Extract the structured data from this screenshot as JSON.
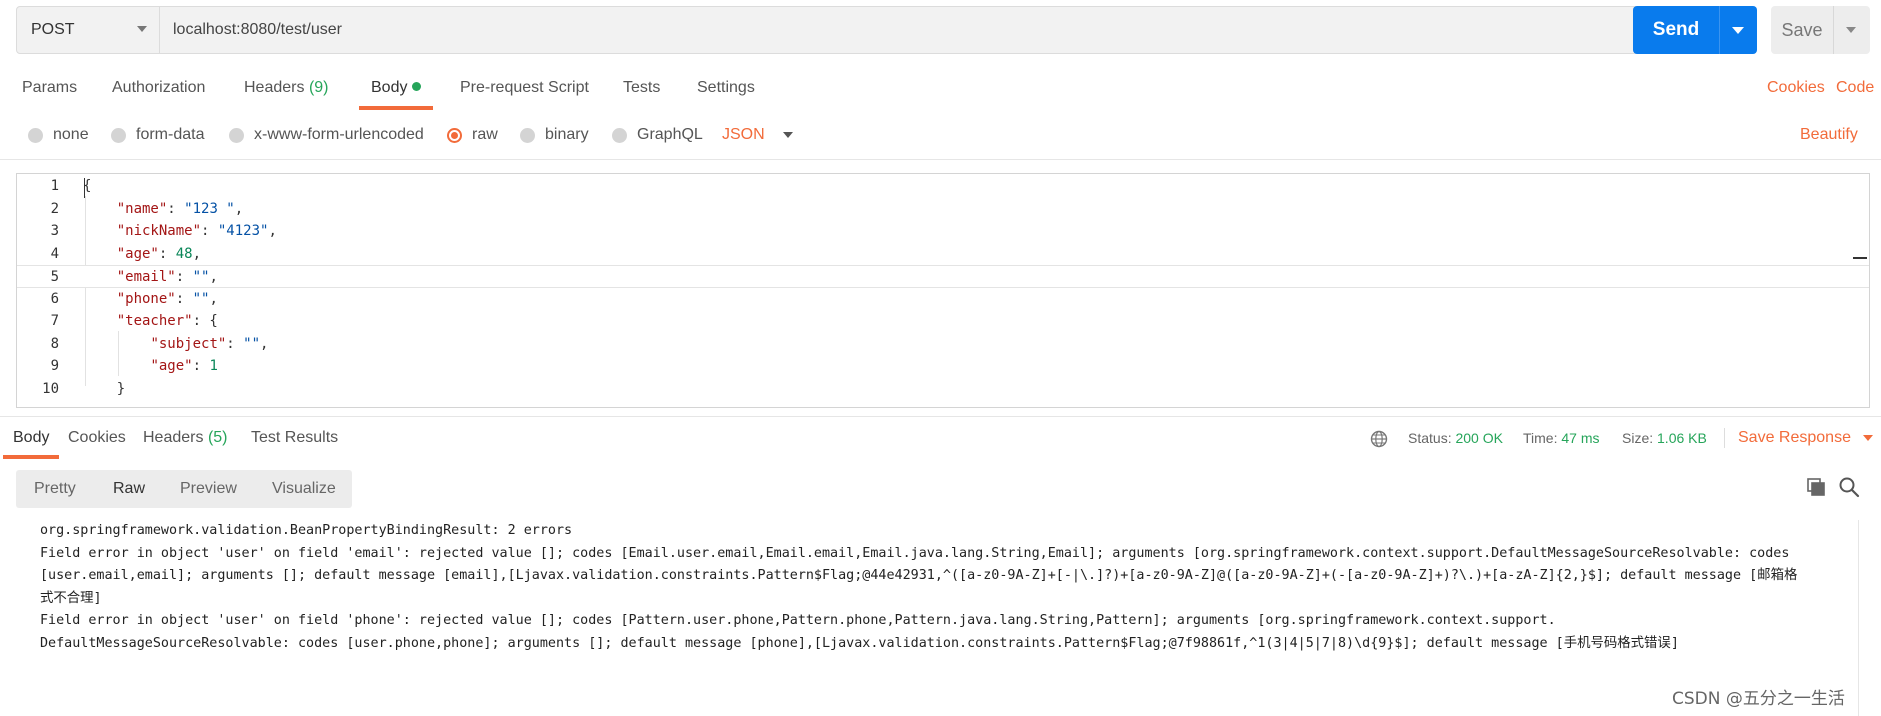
{
  "request": {
    "method": "POST",
    "url": "localhost:8080/test/user",
    "send_label": "Send",
    "save_label": "Save"
  },
  "request_tabs": {
    "params": "Params",
    "authorization": "Authorization",
    "headers": "Headers",
    "headers_count": "(9)",
    "body": "Body",
    "prerequest": "Pre-request Script",
    "tests": "Tests",
    "settings": "Settings",
    "cookies_link": "Cookies",
    "code_link": "Code"
  },
  "body_types": {
    "none": "none",
    "form_data": "form-data",
    "urlencoded": "x-www-form-urlencoded",
    "raw": "raw",
    "binary": "binary",
    "graphql": "GraphQL",
    "selected": "raw",
    "format": "JSON",
    "beautify": "Beautify"
  },
  "editor": {
    "line_numbers": [
      "1",
      "2",
      "3",
      "4",
      "5",
      "6",
      "7",
      "8",
      "9",
      "10"
    ]
  },
  "response_tabs": {
    "body": "Body",
    "cookies": "Cookies",
    "headers": "Headers",
    "headers_count": "(5)",
    "test_results": "Test Results"
  },
  "status": {
    "status_label": "Status:",
    "status_value": "200 OK",
    "time_label": "Time:",
    "time_value": "47 ms",
    "size_label": "Size:",
    "size_value": "1.06 KB",
    "save_response": "Save Response"
  },
  "view_modes": {
    "pretty": "Pretty",
    "raw": "Raw",
    "preview": "Preview",
    "visualize": "Visualize",
    "selected": "Raw"
  },
  "response_lines": [
    "org.springframework.validation.BeanPropertyBindingResult: 2 errors",
    "Field error in object 'user' on field 'email': rejected value []; codes [Email.user.email,Email.email,Email.java.lang.String,Email]; arguments [org.springframework.context.support.DefaultMessageSourceResolvable: codes",
    "[user.email,email]; arguments []; default message [email],[Ljavax.validation.constraints.Pattern$Flag;@44e42931,^([a-z0-9A-Z]+[-|\\.]?)+[a-z0-9A-Z]@([a-z0-9A-Z]+(-[a-z0-9A-Z]+)?\\.)+[a-zA-Z]{2,}$]; default message [邮箱格",
    "式不合理]",
    "Field error in object 'user' on field 'phone': rejected value []; codes [Pattern.user.phone,Pattern.phone,Pattern.java.lang.String,Pattern]; arguments [org.springframework.context.support.",
    "DefaultMessageSourceResolvable: codes [user.phone,phone]; arguments []; default message [phone],[Ljavax.validation.constraints.Pattern$Flag;@7f98861f,^1(3|4|5|7|8)\\d{9}$]; default message [手机号码格式错误]"
  ],
  "watermark": "CSDN @五分之一生活",
  "colors": {
    "accent": "#f26b3a",
    "send_button": "#097bed",
    "success": "#26a55a"
  },
  "icons": {
    "method_dropdown": "chevron-down-icon",
    "globe": "globe-icon",
    "copy": "copy-icon",
    "search": "search-icon"
  }
}
